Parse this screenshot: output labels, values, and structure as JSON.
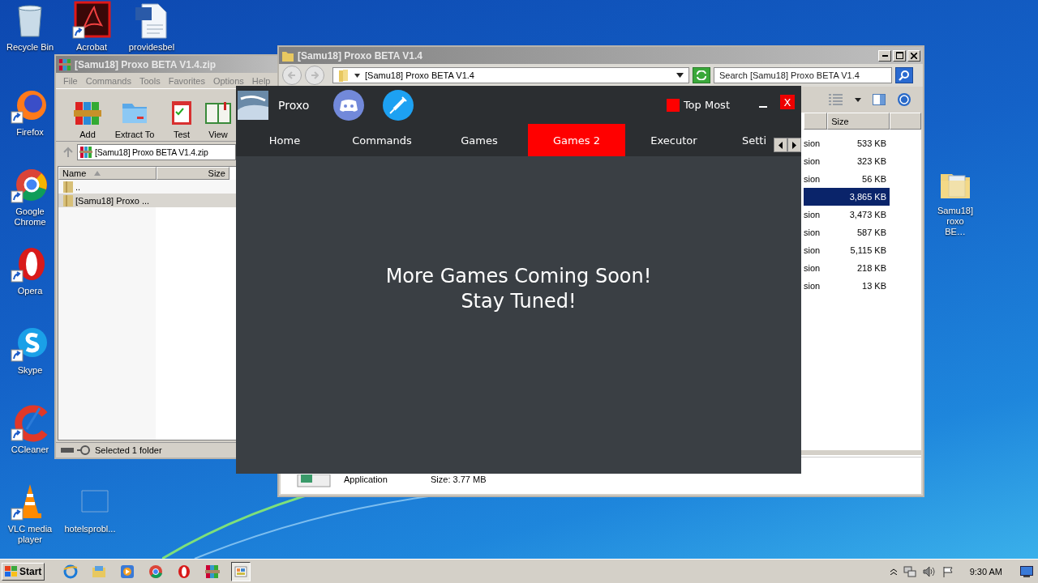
{
  "desktop_icons": [
    {
      "label": "Recycle Bin",
      "kind": "bin",
      "shortcut": false
    },
    {
      "label": "Acrobat",
      "kind": "pdf",
      "shortcut": true
    },
    {
      "label": "providesbel",
      "kind": "doc",
      "shortcut": false
    },
    {
      "label": "Firefox",
      "kind": "firefox",
      "shortcut": true
    },
    {
      "label": "Google Chrome",
      "kind": "chrome",
      "shortcut": true
    },
    {
      "label": "Opera",
      "kind": "opera",
      "shortcut": true
    },
    {
      "label": "Skype",
      "kind": "skype",
      "shortcut": true
    },
    {
      "label": "CCleaner",
      "kind": "ccleaner",
      "shortcut": true
    },
    {
      "label": "VLC media player",
      "kind": "vlc",
      "shortcut": true
    },
    {
      "label": "hotelsprobl...",
      "kind": "blank",
      "shortcut": false
    },
    {
      "label": "Samu18] roxo BE…",
      "kind": "folder",
      "shortcut": false
    }
  ],
  "archive_window": {
    "title": "[Samu18] Proxo BETA V1.4.zip",
    "menu": [
      "File",
      "Commands",
      "Tools",
      "Favorites",
      "Options",
      "Help"
    ],
    "toolbar": [
      {
        "label": "Add",
        "kind": "add"
      },
      {
        "label": "Extract To",
        "kind": "extract"
      },
      {
        "label": "Test",
        "kind": "test"
      },
      {
        "label": "View",
        "kind": "view"
      }
    ],
    "path": "[Samu18] Proxo BETA V1.4.zip",
    "columns": [
      "Name",
      "Size"
    ],
    "rows": [
      {
        "name": "..",
        "selected": false
      },
      {
        "name": "[Samu18] Proxo ...",
        "selected": true
      }
    ],
    "status": "Selected 1 folder"
  },
  "folder_window": {
    "title": "[Samu18] Proxo BETA V1.4",
    "address": "[Samu18] Proxo BETA V1.4",
    "search": {
      "placeholder": "Search [Samu18] Proxo BETA V1.4"
    },
    "columns": [
      "Size"
    ],
    "rows": [
      {
        "type": "sion",
        "size": "533 KB",
        "selected": false
      },
      {
        "type": "sion",
        "size": "323 KB",
        "selected": false
      },
      {
        "type": "sion",
        "size": "56 KB",
        "selected": false
      },
      {
        "size": "3,865 KB",
        "selected": true
      },
      {
        "type": "sion",
        "size": "3,473 KB",
        "selected": false
      },
      {
        "type": "sion",
        "size": "587 KB",
        "selected": false
      },
      {
        "type": "sion",
        "size": "5,115 KB",
        "selected": false
      },
      {
        "type": "sion",
        "size": "218 KB",
        "selected": false
      },
      {
        "type": "sion",
        "size": "13 KB",
        "selected": false
      }
    ],
    "details": {
      "type": "Application",
      "size": "Size: 3.77 MB"
    }
  },
  "proxo_window": {
    "title": "Proxo",
    "top_most": {
      "label": "Top Most",
      "checked": true
    },
    "close": "X",
    "tabs": [
      {
        "label": "Home",
        "selected": false
      },
      {
        "label": "Commands",
        "selected": false
      },
      {
        "label": "Games",
        "selected": false
      },
      {
        "label": "Games 2",
        "selected": true
      },
      {
        "label": "Executor",
        "selected": false
      },
      {
        "label": "Setti",
        "selected": false
      }
    ],
    "message": [
      "More Games Coming Soon!",
      "Stay Tuned!"
    ]
  },
  "taskbar": {
    "start": "Start",
    "apps": [
      {
        "kind": "ie",
        "selected": false
      },
      {
        "kind": "files",
        "selected": false
      },
      {
        "kind": "media",
        "selected": false
      },
      {
        "kind": "chrome",
        "selected": false
      },
      {
        "kind": "opera",
        "selected": false
      },
      {
        "kind": "archive",
        "selected": false
      },
      {
        "kind": "app",
        "selected": true
      }
    ],
    "clock": "9:30 AM"
  }
}
